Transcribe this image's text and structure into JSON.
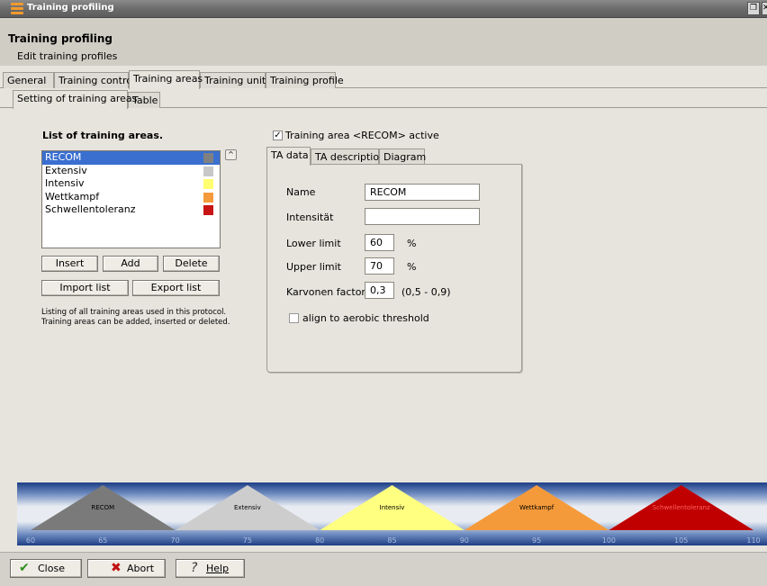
{
  "window": {
    "title": "Training profiling"
  },
  "header": {
    "title": "Training profiling",
    "subtitle": "Edit training profiles"
  },
  "main_tabs": [
    {
      "label": "General"
    },
    {
      "label": "Training control"
    },
    {
      "label": "Training areas",
      "active": true
    },
    {
      "label": "Training units"
    },
    {
      "label": "Training profile"
    }
  ],
  "sub_tabs": [
    {
      "label": "Setting of training areas",
      "active": true
    },
    {
      "label": "Table"
    }
  ],
  "list": {
    "title": "List of training areas.",
    "items": [
      {
        "label": "RECOM",
        "color": "#808080",
        "selected": true
      },
      {
        "label": "Extensiv",
        "color": "#c8c8c8"
      },
      {
        "label": "Intensiv",
        "color": "#ffff70"
      },
      {
        "label": "Wettkampf",
        "color": "#f59a3a"
      },
      {
        "label": "Schwellentoleranz",
        "color": "#c81414"
      }
    ],
    "buttons": {
      "insert": "Insert",
      "add": "Add",
      "delete": "Delete",
      "import": "Import list",
      "export": "Export list"
    },
    "help": "Listing of all training areas used in this protocol. Training areas can be added, inserted or deleted."
  },
  "active_check": {
    "label": "Training area <RECOM> active",
    "checked": true
  },
  "inner_tabs": [
    {
      "label": "TA data",
      "active": true
    },
    {
      "label": "TA description"
    },
    {
      "label": "Diagram"
    }
  ],
  "ta_data": {
    "name_label": "Name",
    "name_value": "RECOM",
    "intensity_label": "Intensität",
    "intensity_value": "",
    "lower_label": "Lower limit",
    "lower_value": "60",
    "upper_label": "Upper limit",
    "upper_value": "70",
    "percent_unit": "%",
    "karvonen_label": "Karvonen factor",
    "karvonen_value": "0,3",
    "karvonen_range": "(0,5 - 0,9)",
    "align_label": "align to aerobic threshold",
    "align_checked": false
  },
  "zone_chart": {
    "scale_min": 60,
    "scale_max": 110,
    "ticks": [
      "60",
      "65",
      "70",
      "75",
      "80",
      "85",
      "90",
      "95",
      "100",
      "105",
      "110"
    ],
    "zones": [
      {
        "label": "RECOM",
        "from": 60,
        "to": 70,
        "color": "#7a7a7a",
        "text_color": "#000000"
      },
      {
        "label": "Extensiv",
        "from": 70,
        "to": 80,
        "color": "#cdcdcd",
        "text_color": "#000000"
      },
      {
        "label": "Intensiv",
        "from": 80,
        "to": 90,
        "color": "#ffff80",
        "text_color": "#000000"
      },
      {
        "label": "Wettkampf",
        "from": 90,
        "to": 100,
        "color": "#f59a3a",
        "text_color": "#000000"
      },
      {
        "label": "Schwellentoleranz",
        "from": 100,
        "to": 110,
        "color": "#c00000",
        "text_color": "#ff6060"
      }
    ]
  },
  "footer": {
    "close": "Close",
    "abort": "Abort",
    "help": "Help"
  },
  "icons": {
    "app": "menu-icon",
    "restore": "restore-icon",
    "close_corner": "close-icon",
    "sort": "sort-up-icon",
    "check": "checkmark-icon",
    "abort": "x-icon",
    "help": "question-icon"
  },
  "colors": {
    "selection": "#3a6fd0",
    "chart_bg_top": "#1f3f86",
    "chart_bg_mid": "#e8ecf2"
  }
}
